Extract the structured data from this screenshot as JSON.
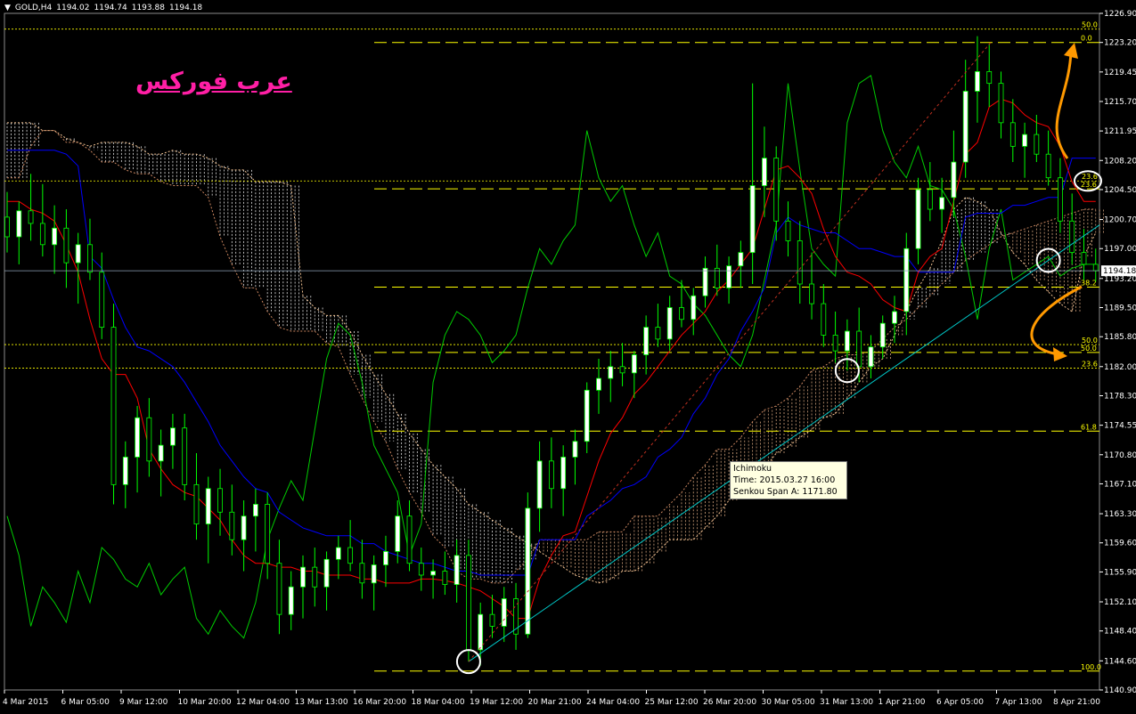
{
  "header": {
    "symbol": "GOLD,H4",
    "ohlc": [
      "1194.02",
      "1194.74",
      "1193.88",
      "1194.18"
    ]
  },
  "logo_text": "عرب فوركس",
  "tooltip": {
    "indicator": "Ichimoku",
    "time": "Time: 2015.03.27 16:00",
    "value": "Senkou Span A: 1171.80"
  },
  "current_price_label": "1194.18",
  "colors": {
    "background": "#000000",
    "up_candle": "#ffffff",
    "down_candle": "#000000",
    "wick": "#00ff00",
    "tenkan": "#ff0000",
    "kijun": "#0000ff",
    "chikou": "#00cc00",
    "cloud": "#ffffff",
    "fib": "#ffff00",
    "trendline": "#00c8c8",
    "fib_diagonal": "#c03020",
    "annotation_arrow": "#ff9900",
    "annotation_circle": "#ffffff"
  },
  "chart_data": {
    "type": "candlestick",
    "title": "GOLD,H4",
    "indicators": [
      "Ichimoku"
    ],
    "ylim": [
      1140.9,
      1226.9
    ],
    "y_ticks": [
      "1226.90",
      "1223.20",
      "1219.45",
      "1215.70",
      "1211.95",
      "1208.20",
      "1204.50",
      "1200.70",
      "1197.00",
      "1193.20",
      "1189.50",
      "1185.80",
      "1182.00",
      "1178.30",
      "1174.55",
      "1170.80",
      "1167.10",
      "1163.30",
      "1159.60",
      "1155.90",
      "1152.10",
      "1148.40",
      "1144.60",
      "1140.90"
    ],
    "x_ticks": [
      "4 Mar 2015",
      "6 Mar 05:00",
      "9 Mar 12:00",
      "10 Mar 20:00",
      "12 Mar 04:00",
      "13 Mar 13:00",
      "16 Mar 20:00",
      "18 Mar 04:00",
      "19 Mar 12:00",
      "20 Mar 21:00",
      "24 Mar 04:00",
      "25 Mar 12:00",
      "26 Mar 20:00",
      "30 Mar 05:00",
      "31 Mar 13:00",
      "1 Apr 21:00",
      "6 Apr 05:00",
      "7 Apr 13:00",
      "8 Apr 21:00"
    ],
    "grid": true,
    "fib_levels": [
      {
        "label": "100.0",
        "value": 1143.3
      },
      {
        "label": "61.8",
        "value": 1173.8
      },
      {
        "label": "50.0",
        "value": 1183.8
      },
      {
        "label": "38.2",
        "value": 1192.1
      },
      {
        "label": "23.6",
        "value": 1204.6
      },
      {
        "label": "0.0",
        "value": 1223.2
      }
    ],
    "fib_levels_right": [
      {
        "label": "50.0",
        "value": 1224.9
      },
      {
        "label": "23.6",
        "value": 1205.6
      },
      {
        "label": "50.0",
        "value": 1184.8
      },
      {
        "label": "23.6",
        "value": 1181.8
      }
    ],
    "current_price": 1194.18,
    "candles": [
      [
        1201.0,
        1204.2,
        1196.5,
        1198.5
      ],
      [
        1198.5,
        1203.0,
        1195.0,
        1201.8
      ],
      [
        1201.8,
        1206.5,
        1198.0,
        1200.2
      ],
      [
        1200.2,
        1205.2,
        1196.0,
        1197.5
      ],
      [
        1197.5,
        1202.5,
        1193.8,
        1199.6
      ],
      [
        1199.6,
        1202.0,
        1192.0,
        1195.2
      ],
      [
        1195.2,
        1199.0,
        1190.0,
        1197.5
      ],
      [
        1197.5,
        1200.8,
        1193.0,
        1194.0
      ],
      [
        1194.0,
        1196.5,
        1185.5,
        1187.0
      ],
      [
        1187.0,
        1190.0,
        1164.5,
        1167.0
      ],
      [
        1167.0,
        1172.5,
        1164.0,
        1170.5
      ],
      [
        1170.5,
        1177.0,
        1166.0,
        1175.5
      ],
      [
        1175.5,
        1178.0,
        1168.0,
        1170.0
      ],
      [
        1170.0,
        1174.0,
        1165.5,
        1172.0
      ],
      [
        1172.0,
        1176.0,
        1169.0,
        1174.2
      ],
      [
        1174.2,
        1176.0,
        1165.0,
        1167.0
      ],
      [
        1167.0,
        1171.0,
        1160.0,
        1162.0
      ],
      [
        1162.0,
        1168.0,
        1157.0,
        1166.5
      ],
      [
        1166.5,
        1169.0,
        1160.5,
        1163.5
      ],
      [
        1163.5,
        1167.0,
        1158.0,
        1160.0
      ],
      [
        1160.0,
        1165.0,
        1156.0,
        1163.0
      ],
      [
        1163.0,
        1166.5,
        1158.5,
        1164.5
      ],
      [
        1164.5,
        1166.0,
        1155.0,
        1157.0
      ],
      [
        1157.0,
        1160.0,
        1148.0,
        1150.5
      ],
      [
        1150.5,
        1156.0,
        1148.5,
        1154.0
      ],
      [
        1154.0,
        1158.0,
        1150.0,
        1156.5
      ],
      [
        1156.5,
        1159.0,
        1151.5,
        1154.0
      ],
      [
        1154.0,
        1158.5,
        1151.0,
        1157.5
      ],
      [
        1157.5,
        1160.5,
        1155.0,
        1159.0
      ],
      [
        1159.0,
        1162.5,
        1156.0,
        1157.0
      ],
      [
        1157.0,
        1160.0,
        1152.5,
        1154.5
      ],
      [
        1154.5,
        1158.0,
        1151.0,
        1156.8
      ],
      [
        1156.8,
        1160.5,
        1154.0,
        1158.5
      ],
      [
        1158.5,
        1165.0,
        1157.0,
        1163.0
      ],
      [
        1163.0,
        1165.0,
        1156.0,
        1157.0
      ],
      [
        1157.0,
        1159.0,
        1153.5,
        1155.5
      ],
      [
        1155.5,
        1157.5,
        1152.5,
        1156.0
      ],
      [
        1156.0,
        1158.5,
        1153.0,
        1154.3
      ],
      [
        1154.3,
        1160.0,
        1152.0,
        1158.0
      ],
      [
        1158.0,
        1160.0,
        1144.5,
        1146.0
      ],
      [
        1146.0,
        1152.0,
        1144.0,
        1150.5
      ],
      [
        1150.5,
        1153.0,
        1147.5,
        1149.0
      ],
      [
        1149.0,
        1154.0,
        1147.0,
        1152.5
      ],
      [
        1152.5,
        1154.5,
        1146.0,
        1148.0
      ],
      [
        1148.0,
        1166.0,
        1147.5,
        1164.0
      ],
      [
        1164.0,
        1172.5,
        1161.0,
        1170.0
      ],
      [
        1170.0,
        1173.0,
        1164.0,
        1166.5
      ],
      [
        1166.5,
        1172.0,
        1163.0,
        1170.5
      ],
      [
        1170.5,
        1174.0,
        1167.0,
        1172.5
      ],
      [
        1172.5,
        1180.0,
        1171.0,
        1179.0
      ],
      [
        1179.0,
        1183.0,
        1176.0,
        1180.5
      ],
      [
        1180.5,
        1184.0,
        1177.5,
        1182.0
      ],
      [
        1182.0,
        1185.0,
        1179.5,
        1181.2
      ],
      [
        1181.2,
        1184.0,
        1178.0,
        1183.5
      ],
      [
        1183.5,
        1188.5,
        1181.0,
        1187.0
      ],
      [
        1187.0,
        1190.0,
        1184.5,
        1185.5
      ],
      [
        1185.5,
        1191.0,
        1184.0,
        1189.5
      ],
      [
        1189.5,
        1193.0,
        1187.0,
        1188.0
      ],
      [
        1188.0,
        1192.0,
        1186.0,
        1191.0
      ],
      [
        1191.0,
        1196.0,
        1189.5,
        1194.5
      ],
      [
        1194.5,
        1197.5,
        1191.0,
        1192.0
      ],
      [
        1192.0,
        1196.0,
        1190.0,
        1194.8
      ],
      [
        1194.8,
        1198.0,
        1192.0,
        1196.5
      ],
      [
        1196.5,
        1218.0,
        1192.5,
        1205.0
      ],
      [
        1205.0,
        1212.5,
        1201.0,
        1208.5
      ],
      [
        1208.5,
        1210.0,
        1198.0,
        1200.5
      ],
      [
        1200.5,
        1203.0,
        1196.0,
        1198.0
      ],
      [
        1198.0,
        1200.5,
        1190.0,
        1192.5
      ],
      [
        1192.5,
        1196.5,
        1188.0,
        1190.0
      ],
      [
        1190.0,
        1192.5,
        1184.5,
        1186.0
      ],
      [
        1186.0,
        1189.0,
        1182.5,
        1184.0
      ],
      [
        1184.0,
        1188.0,
        1181.5,
        1186.5
      ],
      [
        1186.5,
        1189.5,
        1180.0,
        1182.0
      ],
      [
        1182.0,
        1186.0,
        1180.5,
        1184.5
      ],
      [
        1184.5,
        1188.5,
        1183.0,
        1187.5
      ],
      [
        1187.5,
        1191.0,
        1185.0,
        1189.0
      ],
      [
        1189.0,
        1199.0,
        1186.0,
        1197.0
      ],
      [
        1197.0,
        1206.0,
        1195.0,
        1204.5
      ],
      [
        1204.5,
        1208.0,
        1200.5,
        1202.0
      ],
      [
        1202.0,
        1206.0,
        1199.0,
        1203.5
      ],
      [
        1203.5,
        1212.0,
        1201.0,
        1208.0
      ],
      [
        1208.0,
        1221.0,
        1206.0,
        1217.0
      ],
      [
        1217.0,
        1224.0,
        1213.0,
        1219.5
      ],
      [
        1219.5,
        1223.0,
        1215.0,
        1218.0
      ],
      [
        1218.0,
        1219.5,
        1211.0,
        1213.0
      ],
      [
        1213.0,
        1216.0,
        1208.0,
        1210.0
      ],
      [
        1210.0,
        1213.0,
        1206.0,
        1211.5
      ],
      [
        1211.5,
        1214.0,
        1208.0,
        1209.0
      ],
      [
        1209.0,
        1212.0,
        1205.0,
        1206.0
      ],
      [
        1206.0,
        1208.5,
        1199.0,
        1200.5
      ],
      [
        1200.5,
        1204.0,
        1195.0,
        1196.5
      ],
      [
        1196.5,
        1199.5,
        1193.0,
        1195.0
      ],
      [
        1195.0,
        1197.0,
        1192.8,
        1194.18
      ]
    ],
    "tenkan_sen": [
      1203.0,
      1203.0,
      1202.0,
      1201.5,
      1200.5,
      1197.5,
      1194.0,
      1188.0,
      1183.0,
      1181.0,
      1181.0,
      1178.0,
      1171.5,
      1169.0,
      1167.0,
      1166.0,
      1165.5,
      1164.0,
      1162.5,
      1160.0,
      1158.0,
      1157.0,
      1157.0,
      1156.5,
      1156.5,
      1156.0,
      1156.0,
      1155.5,
      1155.5,
      1155.5,
      1155.0,
      1155.0,
      1154.5,
      1154.5,
      1154.5,
      1155.0,
      1155.0,
      1154.8,
      1154.5,
      1154.0,
      1153.5,
      1152.5,
      1151.5,
      1150.0,
      1150.0,
      1155.0,
      1158.0,
      1160.5,
      1161.0,
      1165.5,
      1170.0,
      1173.5,
      1175.5,
      1178.5,
      1180.0,
      1182.0,
      1184.0,
      1186.0,
      1187.5,
      1189.0,
      1191.5,
      1193.0,
      1195.0,
      1197.0,
      1202.0,
      1207.0,
      1207.5,
      1206.0,
      1204.0,
      1199.5,
      1196.0,
      1194.0,
      1193.5,
      1192.5,
      1190.5,
      1189.5,
      1189.0,
      1194.0,
      1196.0,
      1197.0,
      1203.0,
      1209.0,
      1210.5,
      1215.0,
      1216.0,
      1215.5,
      1214.0,
      1213.0,
      1212.5,
      1210.0,
      1205.5,
      1203.0,
      1203.0
    ],
    "kijun_sen": [
      1209.5,
      1209.5,
      1209.5,
      1209.5,
      1209.5,
      1209.0,
      1207.5,
      1196.0,
      1194.5,
      1190.5,
      1187.0,
      1184.5,
      1184.0,
      1183.0,
      1182.0,
      1180.0,
      1177.5,
      1175.0,
      1172.0,
      1170.0,
      1168.0,
      1166.5,
      1166.0,
      1163.5,
      1162.5,
      1161.5,
      1161.0,
      1160.5,
      1160.5,
      1160.5,
      1159.5,
      1159.5,
      1158.5,
      1158.0,
      1157.5,
      1157.0,
      1157.0,
      1156.5,
      1156.0,
      1156.0,
      1155.5,
      1155.5,
      1155.5,
      1155.5,
      1155.5,
      1160.0,
      1160.0,
      1160.0,
      1160.0,
      1163.0,
      1164.0,
      1165.0,
      1166.5,
      1167.0,
      1168.0,
      1170.5,
      1171.5,
      1173.0,
      1176.0,
      1178.0,
      1181.0,
      1183.0,
      1186.5,
      1189.0,
      1192.0,
      1199.0,
      1201.0,
      1200.0,
      1199.5,
      1199.0,
      1199.0,
      1198.0,
      1197.0,
      1197.0,
      1196.5,
      1196.0,
      1196.0,
      1194.0,
      1194.0,
      1194.0,
      1194.0,
      1201.0,
      1201.5,
      1201.5,
      1201.5,
      1202.5,
      1202.5,
      1203.0,
      1203.5,
      1203.5,
      1208.5,
      1208.5,
      1208.5
    ],
    "chikou_span": [
      1163.0,
      1158.0,
      1149.0,
      1154.0,
      1152.0,
      1149.5,
      1156.0,
      1152.0,
      1159.0,
      1157.5,
      1155.0,
      1154.0,
      1157.0,
      1153.0,
      1155.0,
      1156.5,
      1150.0,
      1148.0,
      1151.0,
      1149.0,
      1147.5,
      1152.0,
      1160.0,
      1164.0,
      1167.5,
      1165.0,
      1174.0,
      1183.0,
      1187.5,
      1186.0,
      1180.0,
      1172.0,
      1169.0,
      1166.0,
      1158.0,
      1162.0,
      1180.0,
      1186.0,
      1189.0,
      1188.0,
      1186.0,
      1182.5,
      1184.0,
      1186.0,
      1192.0,
      1197.0,
      1195.0,
      1198.0,
      1200.0,
      1212.0,
      1206.0,
      1203.0,
      1205.0,
      1200.0,
      1196.0,
      1199.0,
      1193.5,
      1192.5,
      1190.0,
      1188.5,
      1186.0,
      1183.5,
      1182.0,
      1186.0,
      1193.0,
      1200.0,
      1218.0,
      1207.0,
      1197.0,
      1195.0,
      1193.5,
      1213.0,
      1218.0,
      1219.0,
      1212.0,
      1208.0,
      1206.0,
      1210.0,
      1205.0,
      1204.5,
      1202.0,
      1196.0,
      1188.0,
      1197.0,
      1202.0,
      1193.0,
      1194.0,
      1195.0,
      1196.0,
      1193.5,
      1194.5,
      1195.0,
      1195.0
    ],
    "senkou_span_a": [
      1213.0,
      1213.0,
      1213.0,
      1212.0,
      1212.0,
      1211.0,
      1210.5,
      1210.0,
      1210.5,
      1210.5,
      1210.5,
      1210.0,
      1209.0,
      1209.0,
      1209.5,
      1209.0,
      1209.0,
      1208.5,
      1207.5,
      1207.0,
      1207.0,
      1205.5,
      1205.5,
      1205.5,
      1205.0,
      1191.0,
      1189.5,
      1188.5,
      1188.5,
      1186.5,
      1183.5,
      1181.0,
      1178.5,
      1176.0,
      1173.5,
      1171.5,
      1169.5,
      1168.0,
      1166.5,
      1164.5,
      1163.5,
      1162.5,
      1161.5,
      1160.5,
      1159.5,
      1158.5,
      1157.5,
      1156.5,
      1155.5,
      1155.0,
      1154.5,
      1155.0,
      1156.0,
      1156.0,
      1157.0,
      1158.5,
      1160.0,
      1160.0,
      1160.0,
      1161.5,
      1163.0,
      1165.0,
      1166.5,
      1168.0,
      1169.0,
      1171.0,
      1171.8,
      1173.0,
      1174.0,
      1175.5,
      1176.0,
      1178.0,
      1180.0,
      1182.0,
      1183.0,
      1186.0,
      1189.0,
      1192.0,
      1194.5,
      1198.0,
      1202.0,
      1203.5,
      1203.0,
      1202.0,
      1199.0,
      1196.5,
      1195.0,
      1193.0,
      1191.5,
      1190.0,
      1189.0,
      1196.0,
      1199.0
    ],
    "senkou_span_b": [
      1206.0,
      1206.0,
      1210.0,
      1212.0,
      1212.0,
      1210.5,
      1210.5,
      1209.5,
      1208.0,
      1208.0,
      1207.0,
      1206.5,
      1206.5,
      1205.5,
      1205.0,
      1205.0,
      1205.0,
      1203.5,
      1198.5,
      1195.0,
      1192.0,
      1192.0,
      1189.0,
      1187.0,
      1186.5,
      1186.5,
      1186.5,
      1185.0,
      1184.5,
      1181.0,
      1178.0,
      1175.0,
      1172.5,
      1169.0,
      1166.0,
      1163.5,
      1160.5,
      1159.0,
      1156.0,
      1155.0,
      1155.0,
      1154.5,
      1154.5,
      1156.0,
      1157.5,
      1160.0,
      1160.0,
      1160.0,
      1160.0,
      1160.0,
      1161.0,
      1161.0,
      1161.0,
      1163.0,
      1163.0,
      1163.0,
      1164.5,
      1166.0,
      1168.0,
      1169.5,
      1171.5,
      1171.5,
      1173.0,
      1175.0,
      1176.5,
      1177.0,
      1178.0,
      1179.5,
      1181.5,
      1182.0,
      1183.0,
      1183.5,
      1183.5,
      1184.0,
      1185.5,
      1187.0,
      1188.0,
      1189.5,
      1191.0,
      1192.5,
      1194.0,
      1195.5,
      1196.5,
      1197.5,
      1198.5,
      1199.0,
      1199.5,
      1200.0,
      1200.5,
      1201.0,
      1201.5,
      1202.0,
      1202.0
    ]
  }
}
